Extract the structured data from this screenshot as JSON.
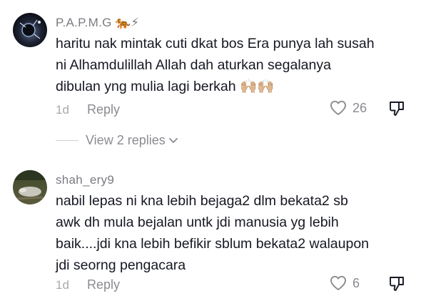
{
  "comments": [
    {
      "username": "P.A.P.M.G",
      "username_emoji": "🐅⚡",
      "text_lines": [
        "haritu nak mintak cuti dkat bos Era punya lah susah",
        "ni Alhamdulillah Allah dah aturkan segalanya",
        "dibulan yng mulia lagi berkah 🙌🏼🙌🏼"
      ],
      "time": "1d",
      "reply_label": "Reply",
      "likes": "26"
    },
    {
      "username": "shah_ery9",
      "text_lines": [
        "nabil lepas ni kna lebih bejaga2 dlm bekata2 sb",
        "awk dh mula bejalan untk jdi manusia yg lebih",
        "baik....jdi kna lebih befikir sblum bekata2 walaupon",
        "jdi seorng pengacara"
      ],
      "time": "1d",
      "reply_label": "Reply",
      "likes": "6"
    }
  ],
  "view_replies_label": "View 2 replies",
  "icons": {
    "like": "heart-outline-icon",
    "dislike": "thumbs-down-icon",
    "expand": "chevron-down-icon"
  },
  "colors": {
    "text": "#161823",
    "muted": "#8a8b91",
    "username": "#7a7b80"
  }
}
